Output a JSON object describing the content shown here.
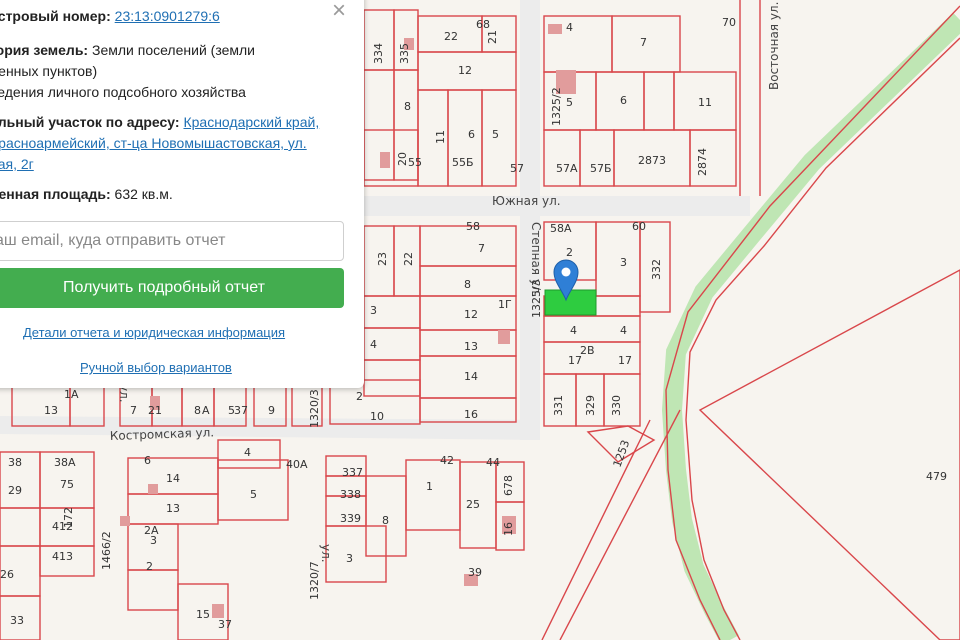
{
  "info_panel": {
    "cadastral_label": "астровый номер:",
    "cadastral_number": "23:13:0901279:6",
    "category_label": "гория земель:",
    "category_value_1": "Земли поселений (земли",
    "category_value_2": "ленных пунктов)",
    "category_value_3": "ведения личного подсобного хозяйства",
    "address_label": "ельный участок по адресу:",
    "address_line_1": "Краснодарский край,",
    "address_line_2": "Красноармейский, ст-ца Новомышастовская, ул.",
    "address_line_3": "ная, 2г",
    "area_label": "ненная площадь:",
    "area_value": "632 кв.м.",
    "email_placeholder": "аш email, куда отправить отчет",
    "get_report_button": "Получить подробный отчет",
    "details_link": "Детали отчета и юридическая информация",
    "manual_link": "Ручной выбор вариантов",
    "close_symbol": "×"
  },
  "map": {
    "streets": {
      "yuzhnaya": "Южная ул.",
      "stepnaya": "Степная ул.",
      "vostochnaya": "Восточная ул.",
      "kostromskaya": "Костромская ул.",
      "ul_left": "ул.",
      "ul_bottom": "ул."
    },
    "selected_parcel_color": "#2ecc40",
    "marker_color": "#2f7fd6",
    "parcel_line_color": "#d9474b",
    "green_strip_color": "#bfe6b4"
  }
}
